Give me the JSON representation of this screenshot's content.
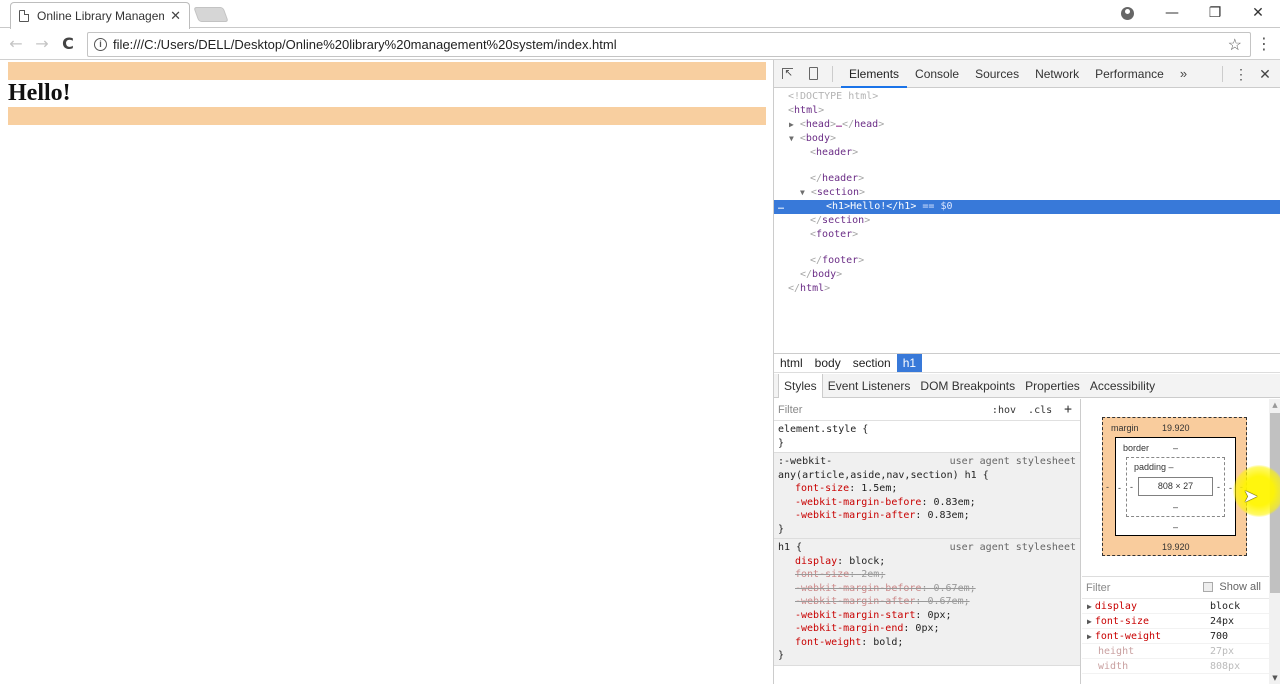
{
  "browser": {
    "tab_title": "Online Library Managem",
    "tab_close": "✕",
    "url": "file:///C:/Users/DELL/Desktop/Online%20library%20management%20system/index.html",
    "icons": {
      "back": "←",
      "forward": "→",
      "reload": "C",
      "info": "i",
      "star": "☆",
      "menu": "⋮",
      "minimize": "—",
      "maximize": "❐",
      "close": "✕"
    }
  },
  "page": {
    "heading": "Hello!",
    "bar_color": "#f8cfa0"
  },
  "devtools": {
    "tabs": [
      "Elements",
      "Console",
      "Sources",
      "Network",
      "Performance"
    ],
    "more": "»",
    "kebab": "⋮",
    "close": "✕",
    "dom": {
      "doctype": "<!DOCTYPE html>",
      "html_open": "html",
      "head": "head",
      "head_ellipsis": "…",
      "body": "body",
      "header": "header",
      "section": "section",
      "h1_text": "Hello!",
      "selected_suffix": " == $0",
      "footer": "footer"
    },
    "breadcrumbs": [
      "html",
      "body",
      "section",
      "h1"
    ],
    "subtabs": [
      "Styles",
      "Event Listeners",
      "DOM Breakpoints",
      "Properties",
      "Accessibility"
    ],
    "styles": {
      "filter_placeholder": "Filter",
      "hov": ":hov",
      "cls": ".cls",
      "plus": "+",
      "element_style": "element.style {",
      "close_brace": "}",
      "rule1": {
        "selector_line1": ":-webkit-",
        "selector_line2": "any(article,aside,nav,section) h1 {",
        "origin": "user agent stylesheet",
        "props": [
          {
            "name": "font-size",
            "value": "1.5em;"
          },
          {
            "name": "-webkit-margin-before",
            "value": "0.83em;"
          },
          {
            "name": "-webkit-margin-after",
            "value": "0.83em;"
          }
        ]
      },
      "rule2": {
        "selector": "h1 {",
        "origin": "user agent stylesheet",
        "props": [
          {
            "name": "display",
            "value": "block;",
            "struck": false
          },
          {
            "name": "font-size",
            "value": "2em;",
            "struck": true
          },
          {
            "name": "-webkit-margin-before",
            "value": "0.67em;",
            "struck": true
          },
          {
            "name": "-webkit-margin-after",
            "value": "0.67em;",
            "struck": true
          },
          {
            "name": "-webkit-margin-start",
            "value": "0px;",
            "struck": false
          },
          {
            "name": "-webkit-margin-end",
            "value": "0px;",
            "struck": false
          },
          {
            "name": "font-weight",
            "value": "bold;",
            "struck": false
          }
        ]
      }
    },
    "box_model": {
      "margin_label": "margin",
      "margin_top": "19.920",
      "margin_bottom": "19.920",
      "margin_left": "-",
      "margin_right": "-",
      "border_label": "border",
      "border_top": "–",
      "border_bottom": "–",
      "border_left": "-",
      "border_right": "-",
      "padding_label": "padding –",
      "padding_bottom": "–",
      "padding_left": "-",
      "padding_right": "-",
      "content": "808 × 27"
    },
    "computed": {
      "filter_placeholder": "Filter",
      "show_all": "Show all",
      "rows": [
        {
          "name": "display",
          "value": "block",
          "inherited": false
        },
        {
          "name": "font-size",
          "value": "24px",
          "inherited": false
        },
        {
          "name": "font-weight",
          "value": "700",
          "inherited": false
        },
        {
          "name": "height",
          "value": "27px",
          "inherited": true
        },
        {
          "name": "width",
          "value": "808px",
          "inherited": true
        }
      ]
    }
  }
}
